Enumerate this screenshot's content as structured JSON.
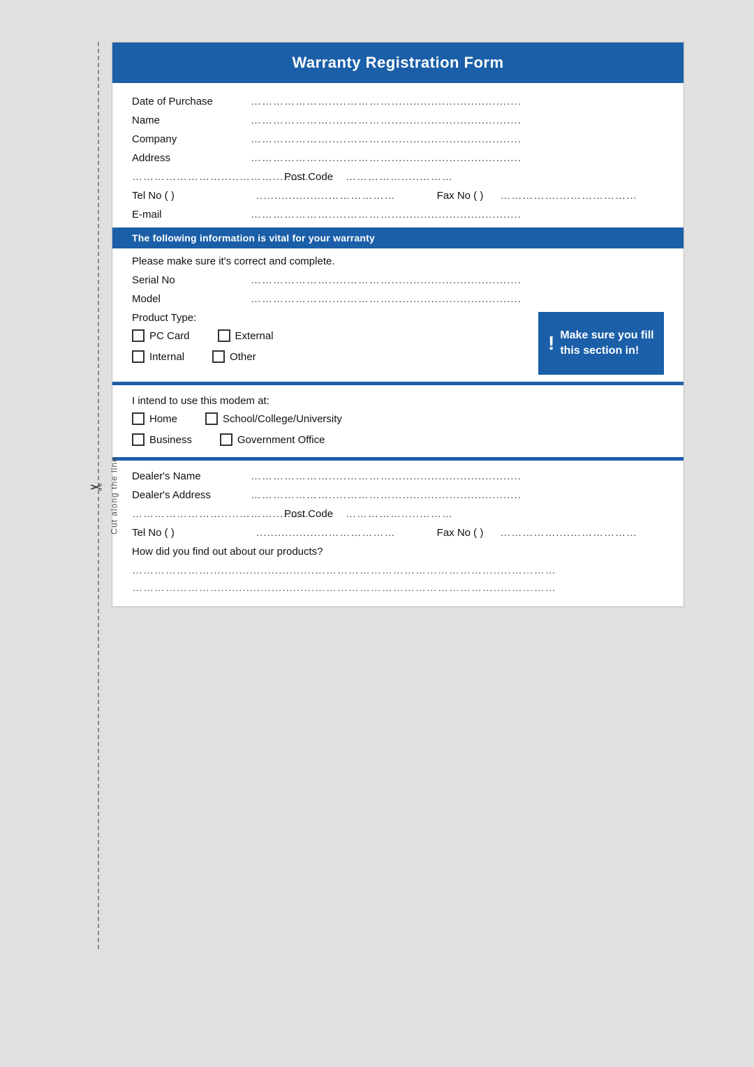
{
  "form": {
    "title": "Warranty Registration Form",
    "fields": {
      "date_of_purchase_label": "Date of Purchase",
      "name_label": "Name",
      "company_label": "Company",
      "address_label": "Address",
      "post_code_label": "Post Code",
      "tel_no_label": "Tel  No (   )",
      "fax_no_label": "Fax No (   )",
      "email_label": "E-mail",
      "serial_no_label": "Serial No",
      "model_label": "Model",
      "dots": "………………………....…………...................................."
    },
    "section_banner": "The following information is vital for your warranty",
    "section_note": "Please make sure it's correct and complete.",
    "product_type_label": "Product Type:",
    "product_type_options": [
      "PC Card",
      "External",
      "Internal",
      "Other"
    ],
    "make_sure_text": "Make sure you fill this section in!",
    "intend_label": "I intend to use this modem at:",
    "intend_options": [
      "Home",
      "School/College/University",
      "Business",
      "Government Office"
    ],
    "dealer_name_label": "Dealer's Name",
    "dealer_address_label": "Dealer's  Address",
    "how_label": "How did you find out about our products?",
    "cut_label": "Cut along the line"
  }
}
